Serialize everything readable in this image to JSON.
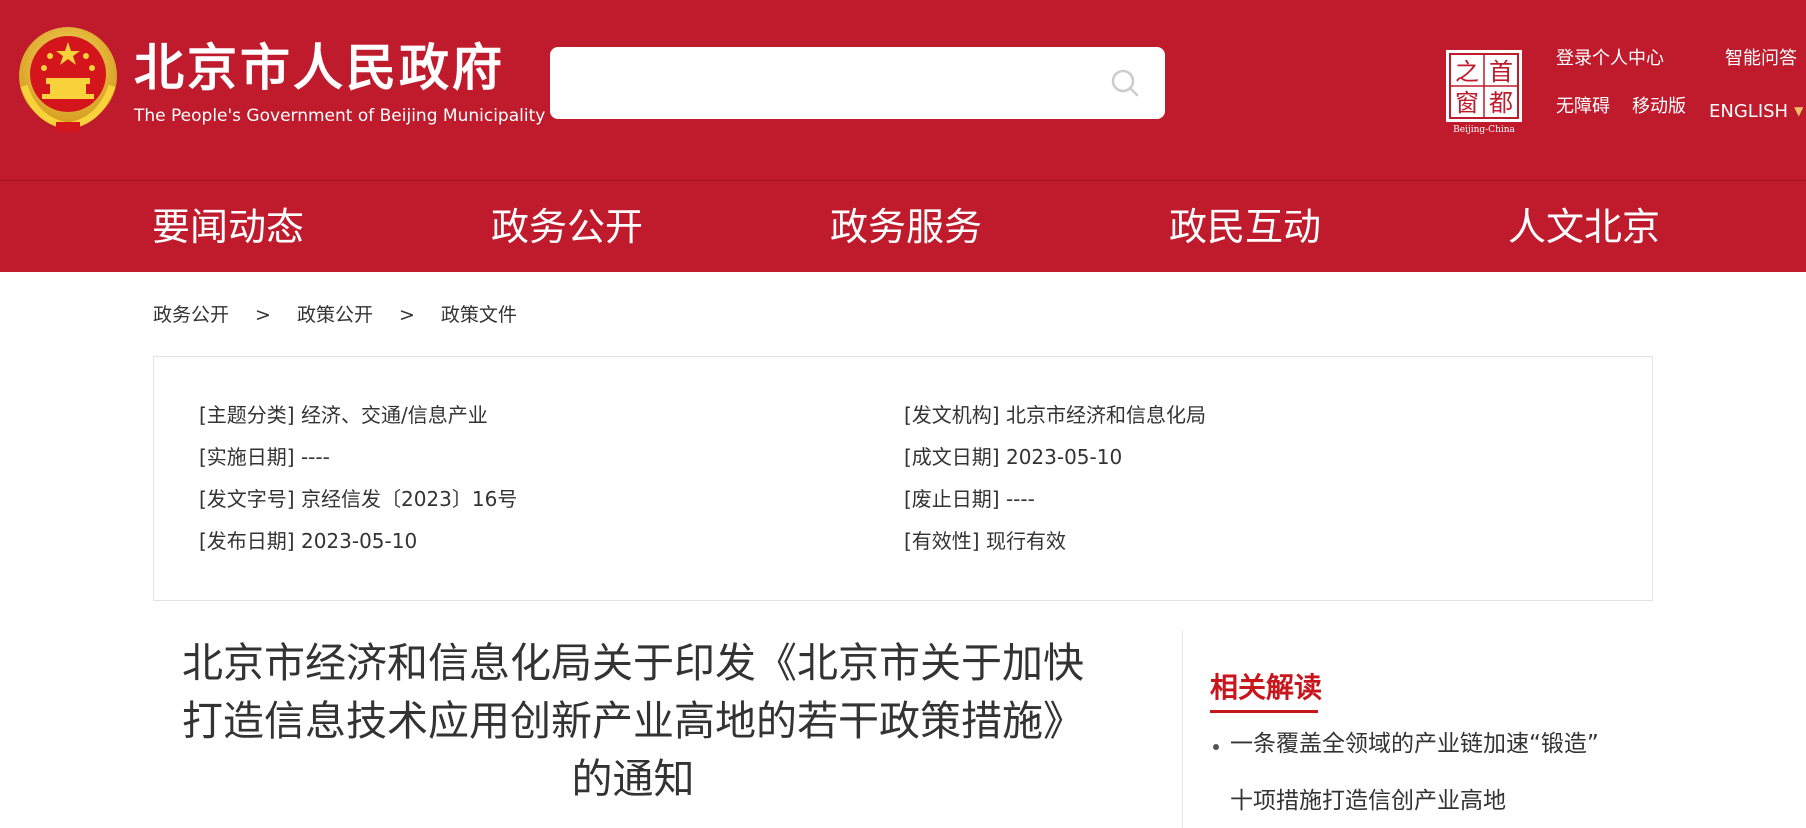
{
  "header": {
    "site_title": "北京市人民政府",
    "site_subtitle": "The People's Government of Beijing Municipality",
    "search": {
      "value": "",
      "placeholder": ""
    },
    "capital_logo": {
      "chars": [
        "首",
        "之",
        "都",
        "窗"
      ],
      "caption": "Beijing-China"
    },
    "links": {
      "login": "登录个人中心",
      "smart_qa": "智能问答",
      "accessibility": "无障碍",
      "mobile": "移动版",
      "english": "ENGLISH",
      "english_arrow": "▼"
    }
  },
  "nav": {
    "items": [
      {
        "label": "要闻动态"
      },
      {
        "label": "政务公开"
      },
      {
        "label": "政务服务"
      },
      {
        "label": "政民互动"
      },
      {
        "label": "人文北京"
      }
    ]
  },
  "breadcrumb": {
    "items": [
      "政务公开",
      "政策公开",
      "政策文件"
    ],
    "separator": ">"
  },
  "meta": {
    "topic": {
      "label": "[主题分类]",
      "value": "经济、交通/信息产业"
    },
    "issuer": {
      "label": "[发文机构]",
      "value": "北京市经济和信息化局"
    },
    "effective_date": {
      "label": "[实施日期]",
      "value": "----"
    },
    "written_date": {
      "label": "[成文日期]",
      "value": "2023-05-10"
    },
    "doc_number": {
      "label": "[发文字号]",
      "value": "京经信发〔2023〕16号"
    },
    "expiry_date": {
      "label": "[废止日期]",
      "value": "----"
    },
    "publish_date": {
      "label": "[发布日期]",
      "value": "2023-05-10"
    },
    "validity": {
      "label": "[有效性]",
      "value": "现行有效"
    }
  },
  "article": {
    "title_line1": "北京市经济和信息化局关于印发《北京市关于加快",
    "title_line2": "打造信息技术应用创新产业高地的若干政策措施》",
    "title_line3": "的通知"
  },
  "related": {
    "heading": "相关解读",
    "items": [
      {
        "line1": "一条覆盖全领域的产业链加速“锻造”",
        "line2": "十项措施打造信创产业高地"
      }
    ]
  },
  "colors": {
    "brand_red": "#bf1b2c",
    "accent_red": "#c8161d",
    "emblem_gold": "#f2c230"
  }
}
